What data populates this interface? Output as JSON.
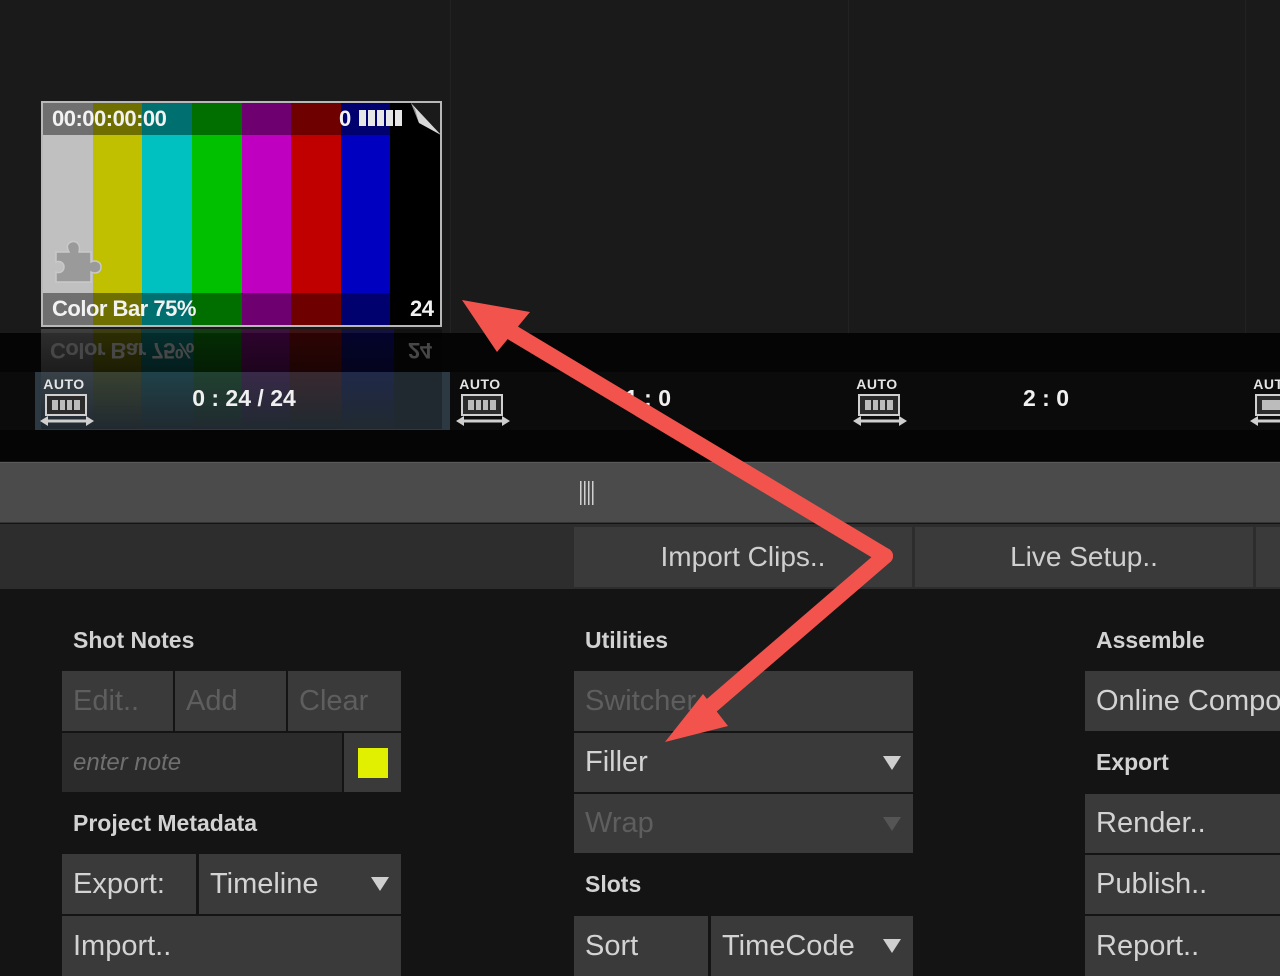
{
  "clip": {
    "timecode": "00:00:00:00",
    "counter": "0",
    "name": "Color Bar 75%",
    "frames": "24",
    "bar_colors": [
      "#c0c0c0",
      "#c0c000",
      "#00c0c0",
      "#00c000",
      "#c000c0",
      "#c00000",
      "#0000c0",
      "#000000"
    ]
  },
  "slots": {
    "auto_label": "AUTO",
    "values": [
      "0 : 24 / 24",
      "1 : 0",
      "2 : 0"
    ]
  },
  "toolbar": {
    "import_clips": "Import Clips..",
    "live_setup": "Live Setup.."
  },
  "shot_notes": {
    "title": "Shot Notes",
    "edit": "Edit..",
    "add": "Add",
    "clear": "Clear",
    "note_placeholder": "enter note",
    "note_color": "#e1f000"
  },
  "project_metadata": {
    "title": "Project Metadata",
    "export_label": "Export:",
    "export_value": "Timeline",
    "import": "Import.."
  },
  "utilities": {
    "title": "Utilities",
    "switcher": "Switcher",
    "filler": "Filler",
    "wrap": "Wrap"
  },
  "slots_panel": {
    "title": "Slots",
    "sort": "Sort",
    "sort_value": "TimeCode"
  },
  "assemble": {
    "title": "Assemble",
    "online_compo": "Online Compo"
  },
  "export": {
    "title": "Export",
    "render": "Render..",
    "publish": "Publish..",
    "report": "Report.."
  },
  "annotation": {
    "arrow_color": "#f2544d"
  }
}
